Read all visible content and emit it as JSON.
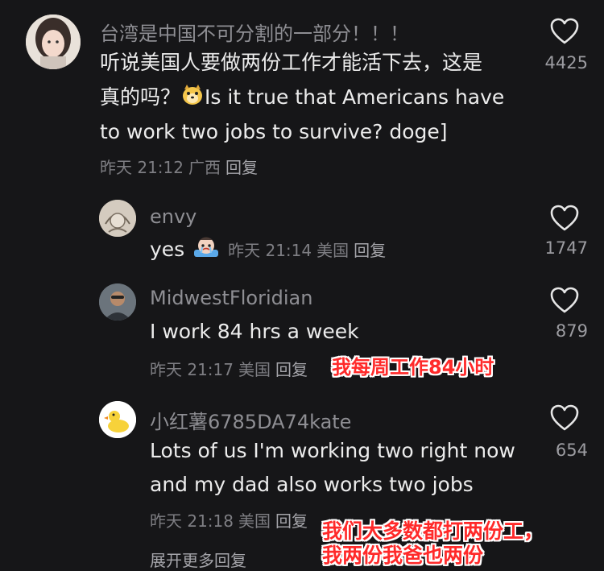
{
  "comments": [
    {
      "username": "台湾是中国不可分割的一部分！！！",
      "line1": "听说美国人要做两份工作才能活下去，这是",
      "line2_pre": "真的吗？",
      "line2_post": "Is it true that Americans have",
      "line3": "to work two jobs to survive? doge]",
      "time": "昨天 21:12",
      "location": "广西",
      "reply": "回复",
      "likes": "4425",
      "avatar_icon": "girl-portrait-avatar",
      "inline_emoji": "doge-emoji"
    },
    {
      "username": "envy",
      "text": "yes",
      "time": "昨天 21:14",
      "location": "美国",
      "reply": "回复",
      "likes": "1747",
      "inline_emoji": "crying-emoji"
    },
    {
      "username": "MidwestFloridian",
      "text": "I work 84 hrs a week",
      "time": "昨天 21:17",
      "location": "美国",
      "reply": "回复",
      "likes": "879",
      "overlay": "我每周工作84小时"
    },
    {
      "username": "小红薯6785DA74kate",
      "line1": "Lots of us I'm working two right now",
      "line2": "and my dad also works two jobs",
      "time": "昨天 21:18",
      "location": "美国",
      "reply": "回复",
      "likes": "654",
      "overlay_line1": "我们大多数都打两份工，",
      "overlay_line2": "我两份我爸也两份",
      "avatar_icon": "duck-avatar"
    }
  ],
  "expand_more": "展开更多回复",
  "colors": {
    "background": "#161618",
    "overlay_red": "#ff2a2a",
    "muted": "#8e8e93"
  }
}
